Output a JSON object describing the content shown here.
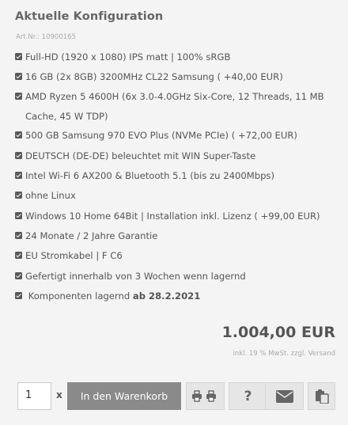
{
  "title": "Aktuelle Konfiguration",
  "art_nr": "Art.Nr.: 10900165",
  "features": [
    "Full-HD (1920 x 1080) IPS matt | 100% sRGB",
    "16 GB (2x 8GB) 3200MHz CL22 Samsung ( +40,00 EUR)",
    "AMD Ryzen 5 4600H (6x 3.0-4.0GHz Six-Core, 12 Threads, 11 MB",
    "DEUTSCH (DE-DE) beleuchtet mit WIN Super-Taste",
    "Intel Wi-Fi 6 AX200 & Bluetooth 5.1 (bis zu 2400Mbps)",
    "ohne Linux",
    "Windows 10 Home 64Bit | Installation inkl. Lizenz ( +99,00 EUR)",
    "24 Monate / 2 Jahre Garantie",
    "EU Stromkabel | F C6",
    "Gefertigt innerhalb von 3 Wochen wenn lagernd"
  ],
  "feature_cpu_cont": "Cache, 45 W TDP)",
  "feature_ssd": "500 GB Samsung 970 EVO Plus (NVMe PCIe) ( +72,00 EUR)",
  "stock_prefix": "Komponenten lagernd",
  "stock_date": "ab 28.2.2021",
  "price": "1.004,00 EUR",
  "tax_note": "inkl. 19 % MwSt. zzgl. Versand",
  "quantity": "1",
  "times": "x",
  "cart_label": "In den Warenkorb",
  "help_label": "?",
  "icons": [
    "print-icon",
    "question-icon",
    "envelope-icon",
    "clipboard-icon",
    "checkbox-icon"
  ]
}
